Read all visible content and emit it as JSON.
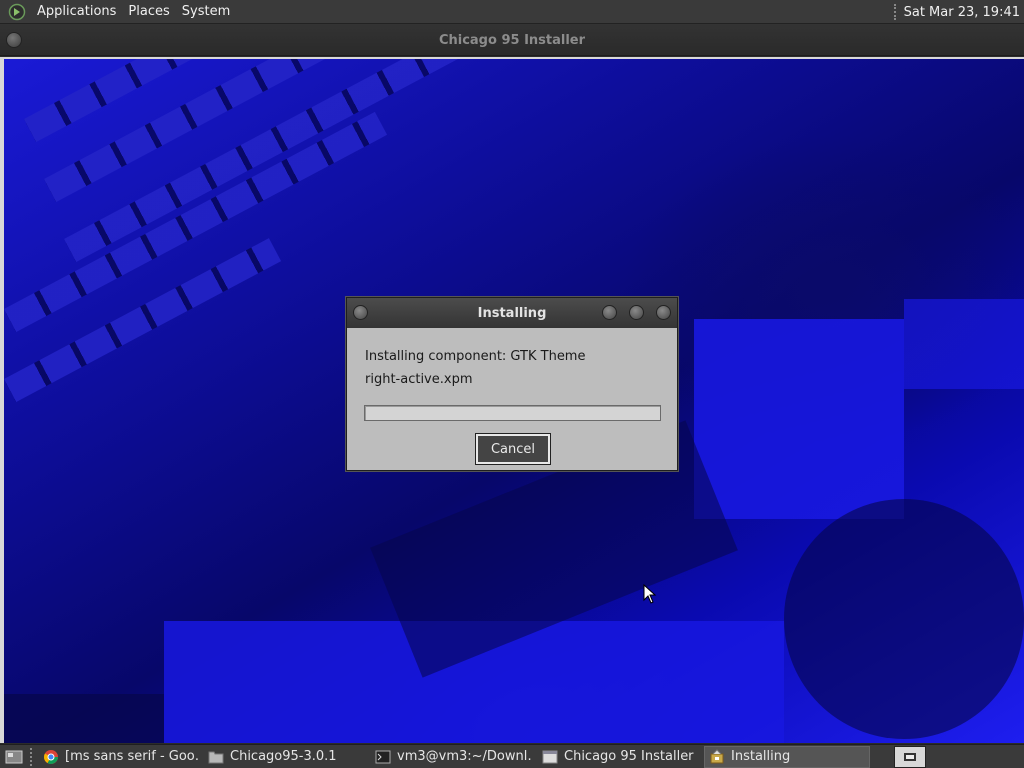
{
  "top_panel": {
    "menus": [
      "Applications",
      "Places",
      "System"
    ],
    "clock": "Sat Mar 23, 19:41"
  },
  "window": {
    "title": "Chicago 95 Installer"
  },
  "dialog": {
    "title": "Installing",
    "line1": "Installing component: GTK Theme",
    "line2": "right-active.xpm",
    "progress": 0,
    "cancel_label": "Cancel"
  },
  "taskbar": {
    "tasks": [
      {
        "label": "[ms sans serif - Goo…",
        "icon": "chrome-icon",
        "active": false
      },
      {
        "label": "Chicago95-3.0.1",
        "icon": "folder-icon",
        "active": false
      },
      {
        "label": "vm3@vm3:~/Downl…",
        "icon": "terminal-icon",
        "active": false
      },
      {
        "label": "Chicago 95 Installer",
        "icon": "window-icon",
        "active": false
      },
      {
        "label": "Installing",
        "icon": "installer-icon",
        "active": true
      }
    ]
  },
  "colors": {
    "panel": "#3a3a3a",
    "desktop_blue": "#1a1ad6",
    "dialog_bg": "#bdbdbd"
  }
}
